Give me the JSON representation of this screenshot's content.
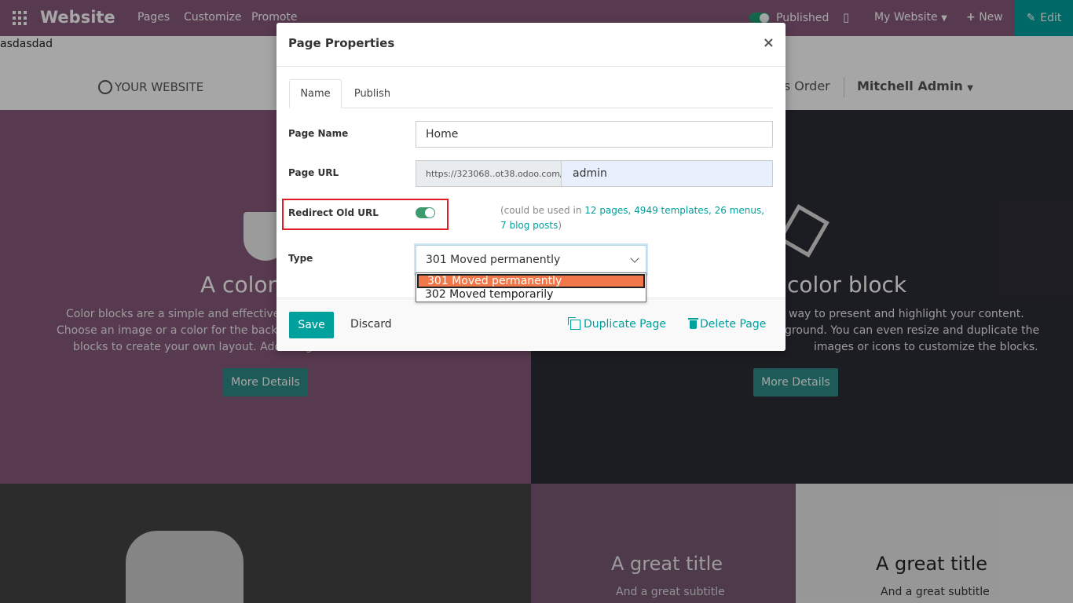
{
  "topbar": {
    "brand": "Website",
    "menu": [
      "Pages",
      "Customize",
      "Promote"
    ],
    "published_label": "Published",
    "site_label": "My Website",
    "new_label": "New",
    "edit_label": "Edit"
  },
  "stray_text": "asdasdad",
  "site_header": {
    "logo": "YOUR WEBSITE",
    "sales_order": "es Order",
    "user": "Mitchell Admin"
  },
  "blocks": {
    "left_title": "A color",
    "left_text": [
      "Color blocks are a simple and effective way",
      "Choose an image or a color for the backgrou",
      "blocks to create your own layout. Add imag"
    ],
    "right_title": "color block",
    "right_text": [
      "way to present and highlight your content.",
      "ground. You can even resize and duplicate the",
      "images or icons to customize the blocks."
    ],
    "more_details": "More Details",
    "great_title": "A great title",
    "great_subtitle": "And a great subtitle"
  },
  "modal": {
    "title": "Page Properties",
    "close": "×",
    "tabs": [
      "Name",
      "Publish"
    ],
    "page_name_label": "Page Name",
    "page_name_value": "Home",
    "page_url_label": "Page URL",
    "url_prefix": "https://323068..ot38.odoo.com/",
    "url_value": "admin",
    "redirect_label": "Redirect Old URL",
    "usage": {
      "prefix": "(could be used in ",
      "links": "12 pages, 4949 templates, 26 menus, 7 blog posts",
      "suffix": ")"
    },
    "type_label": "Type",
    "type_value": "301 Moved permanently",
    "type_options": [
      "301 Moved permanently",
      "302 Moved temporarily"
    ],
    "save": "Save",
    "discard": "Discard",
    "duplicate": "Duplicate Page",
    "delete": "Delete Page"
  },
  "colors": {
    "topbar": "#875a7b",
    "accent": "#00a09d",
    "highlight": "#e01b24",
    "option_selected": "#f0784a"
  }
}
